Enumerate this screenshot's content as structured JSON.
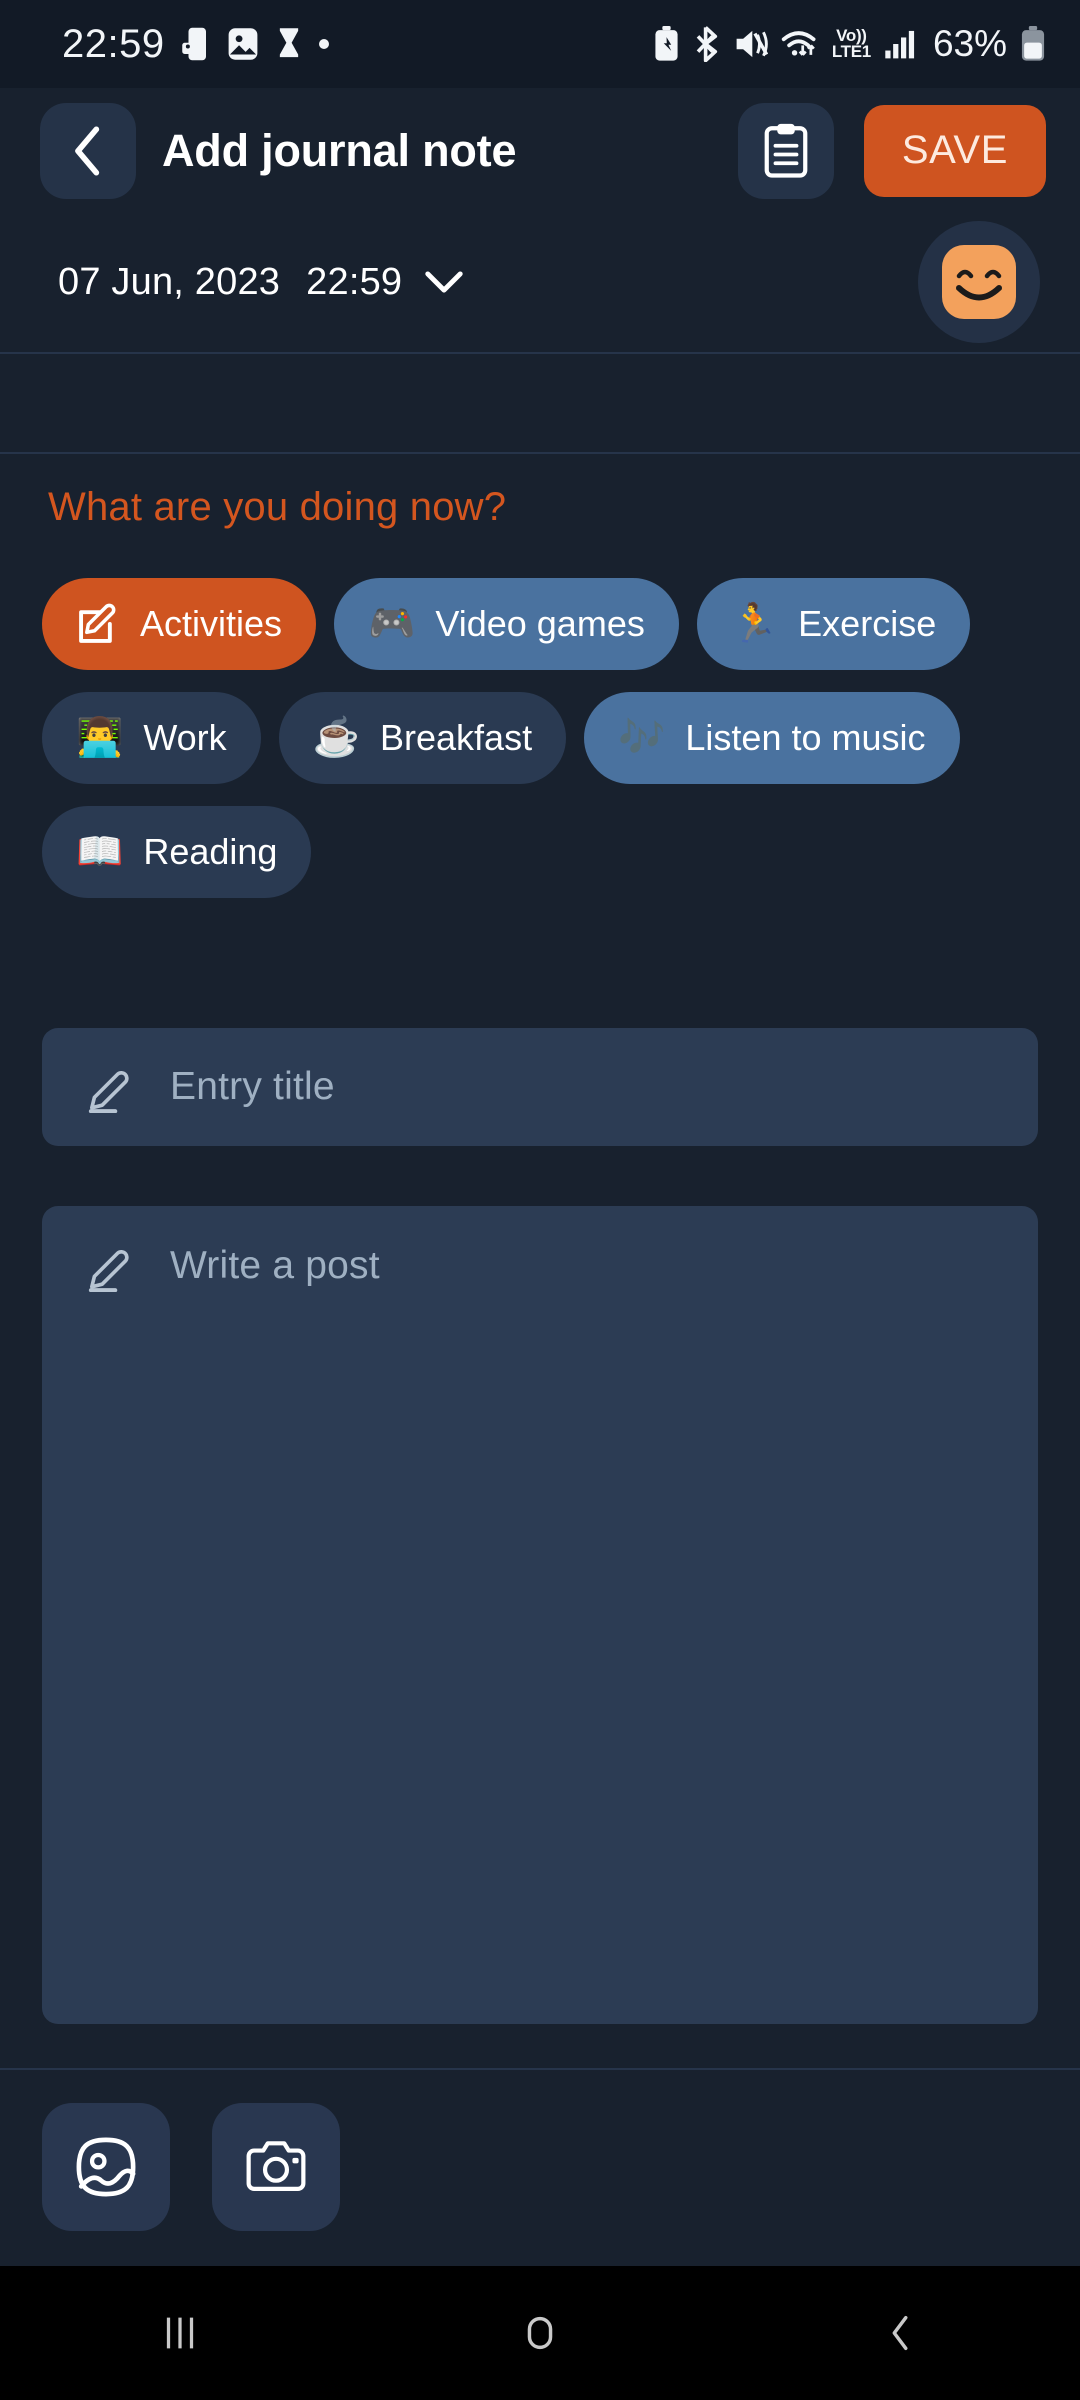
{
  "status_bar": {
    "clock": "22:59",
    "left_icons": [
      "phone-lock-icon",
      "photo-icon",
      "hourglass-icon",
      "dot-indicator"
    ],
    "right_icons": [
      "battery-saver-icon",
      "bluetooth-icon",
      "mute-icon",
      "wifi-icon",
      "signal-bars-icon"
    ],
    "volte_label_top": "Vo))",
    "volte_label_bottom": "LTE1",
    "battery_percent": "63%"
  },
  "app_bar": {
    "back_label": "back",
    "title": "Add journal note",
    "template_icon": "clipboard-icon",
    "save_label": "SAVE"
  },
  "date_row": {
    "date": "07 Jun, 2023",
    "time": "22:59",
    "expand_icon": "chevron-down-icon",
    "mood": "smiley-happy"
  },
  "activities": {
    "prompt": "What are you doing now?",
    "chips": [
      {
        "label": "Activities",
        "emoji": "",
        "icon": "edit-note-icon",
        "state": "accent"
      },
      {
        "label": "Video games",
        "emoji": "🎮",
        "icon": "",
        "state": "selected"
      },
      {
        "label": "Exercise",
        "emoji": "🏃",
        "icon": "",
        "state": "selected"
      },
      {
        "label": "Work",
        "emoji": "👨‍💻",
        "icon": "",
        "state": "default"
      },
      {
        "label": "Breakfast",
        "emoji": "☕",
        "icon": "",
        "state": "default"
      },
      {
        "label": "Listen to music",
        "emoji": "🎶",
        "icon": "",
        "state": "selected"
      },
      {
        "label": "Reading",
        "emoji": "📖",
        "icon": "",
        "state": "default"
      }
    ]
  },
  "entry": {
    "title_placeholder": "Entry title",
    "title_value": "",
    "body_placeholder": "Write a post",
    "body_value": ""
  },
  "bottom_actions": [
    {
      "name": "gallery-button",
      "icon": "image-icon"
    },
    {
      "name": "camera-button",
      "icon": "camera-icon"
    }
  ],
  "nav_bar": {
    "recents_label": "recents",
    "home_label": "home",
    "back_label": "back"
  },
  "colors": {
    "background": "#18212e",
    "status_bar_bg": "#121a26",
    "accent": "#cf5420",
    "chip_selected": "#4a729f",
    "chip_default": "#2a3a52",
    "field_bg": "#2c3c54",
    "mood": "#f3a15c"
  }
}
